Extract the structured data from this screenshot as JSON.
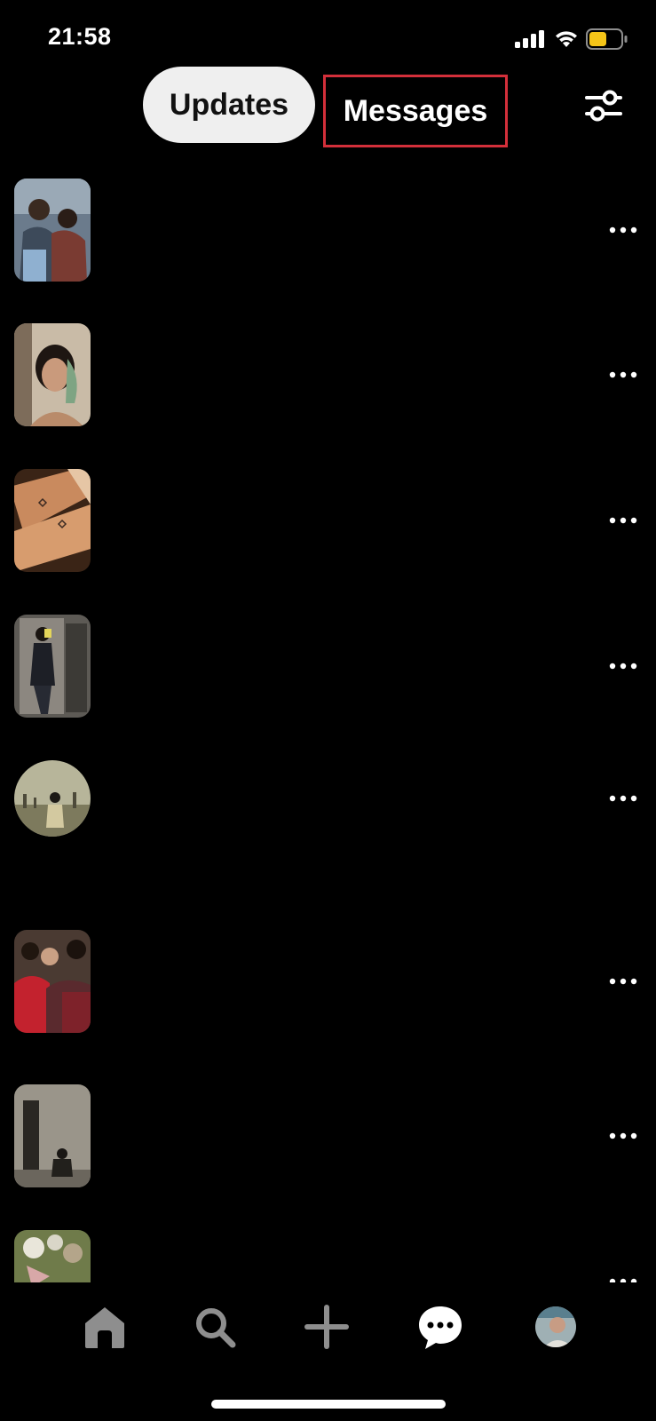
{
  "status_bar": {
    "time": "21:58",
    "signal_icon": "cellular-signal-icon",
    "wifi_icon": "wifi-icon",
    "battery_icon": "battery-icon",
    "battery_color": "#f5c518"
  },
  "header": {
    "tabs": [
      {
        "label": "Updates",
        "active": true
      },
      {
        "label": "Messages",
        "active": false
      }
    ],
    "filter_icon": "sliders-icon",
    "highlight_color": "#d32f3a"
  },
  "list": {
    "items": [
      {
        "thumb": "photo-couple",
        "shape": "rounded-rect"
      },
      {
        "thumb": "photo-woman-portrait",
        "shape": "rounded-rect"
      },
      {
        "thumb": "photo-tattoo-arms",
        "shape": "rounded-rect"
      },
      {
        "thumb": "photo-mirror-selfie",
        "shape": "rounded-rect"
      },
      {
        "thumb": "photo-city-person",
        "shape": "circle"
      },
      {
        "thumb": "photo-group-scene",
        "shape": "rounded-rect"
      },
      {
        "thumb": "photo-room-person",
        "shape": "rounded-rect"
      },
      {
        "thumb": "photo-flowers",
        "shape": "rounded-rect"
      }
    ],
    "more_icon": "more-horizontal-icon"
  },
  "bottom_nav": {
    "items": [
      "home-icon",
      "search-icon",
      "create-plus-icon",
      "messages-chat-icon",
      "profile-avatar"
    ],
    "icon_color": "#8e8e8e"
  }
}
